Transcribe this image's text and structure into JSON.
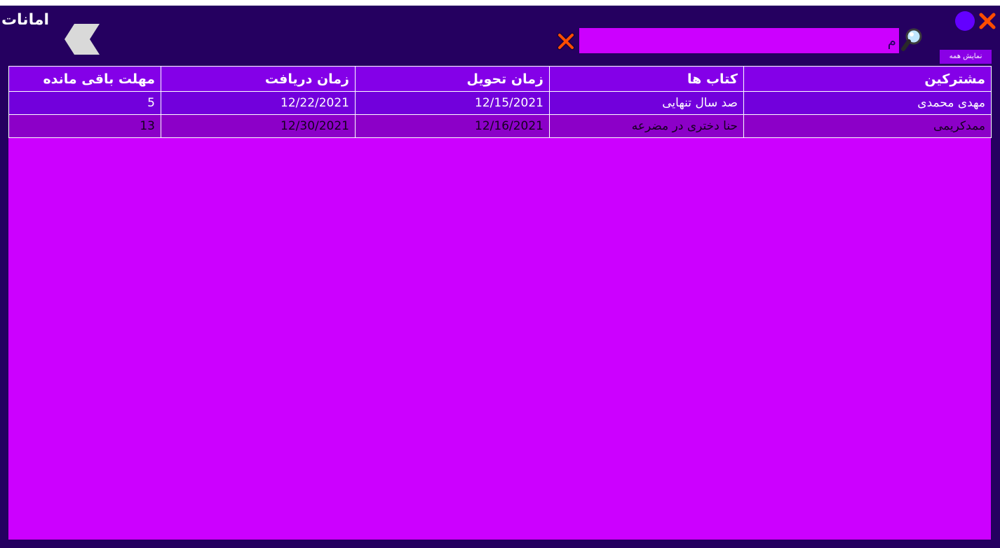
{
  "window": {
    "title": "امانات"
  },
  "toolbar": {
    "search_value": "م",
    "show_all_label": "نمایش همه"
  },
  "icons": {
    "back": "chevron-left-icon",
    "search": "magnifier-icon",
    "clear": "close-x-icon",
    "minimize": "circle-icon",
    "close": "close-x-icon"
  },
  "colors": {
    "window_bg": "#250060",
    "search_bg": "#cc00ff",
    "grid_bg": "#cc00ff",
    "header_bg": "#8400e8",
    "close_x": "#ff4d00",
    "minimize": "#6400ff",
    "back_button": "#d9d9d9"
  },
  "table": {
    "columns": [
      "مشترکین",
      "کتاب ها",
      "زمان تحویل",
      "زمان دریافت",
      "مهلت باقی مانده"
    ],
    "rows": [
      [
        "مهدی محمدی",
        "صد سال تنهایی",
        "12/15/2021",
        "12/22/2021",
        "5"
      ],
      [
        "ممدکریمی",
        "حنا دختری در مضرعه",
        "12/16/2021",
        "12/30/2021",
        "13"
      ]
    ]
  }
}
